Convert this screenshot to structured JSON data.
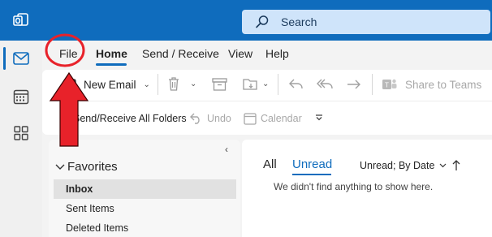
{
  "search": {
    "placeholder": "Search"
  },
  "menu": {
    "tabs": [
      "File",
      "Home",
      "Send / Receive",
      "View",
      "Help"
    ],
    "active": "Home"
  },
  "ribbon": {
    "new_email": "New Email",
    "share_to_teams": "Share to Teams",
    "send_receive_all": "Send/Receive All Folders",
    "undo": "Undo",
    "calendar": "Calendar"
  },
  "folders": {
    "group": "Favorites",
    "items": [
      "Inbox",
      "Sent Items",
      "Deleted Items"
    ],
    "selected": "Inbox"
  },
  "message_list": {
    "tabs": [
      "All",
      "Unread"
    ],
    "active_tab": "Unread",
    "sort": "Unread; By Date",
    "empty_message": "We didn't find anything to show here."
  },
  "colors": {
    "brand": "#0f6cbd",
    "annotation": "#e8222a"
  },
  "icons": [
    "outlook-logo-icon",
    "search-icon",
    "mail-icon",
    "calendar-icon",
    "apps-icon",
    "new-email-icon",
    "delete-icon",
    "archive-icon",
    "move-icon",
    "reply-icon",
    "reply-all-icon",
    "forward-icon",
    "teams-icon",
    "undo-icon",
    "calendar-small-icon",
    "overflow-icon",
    "sort-arrow-icon"
  ]
}
